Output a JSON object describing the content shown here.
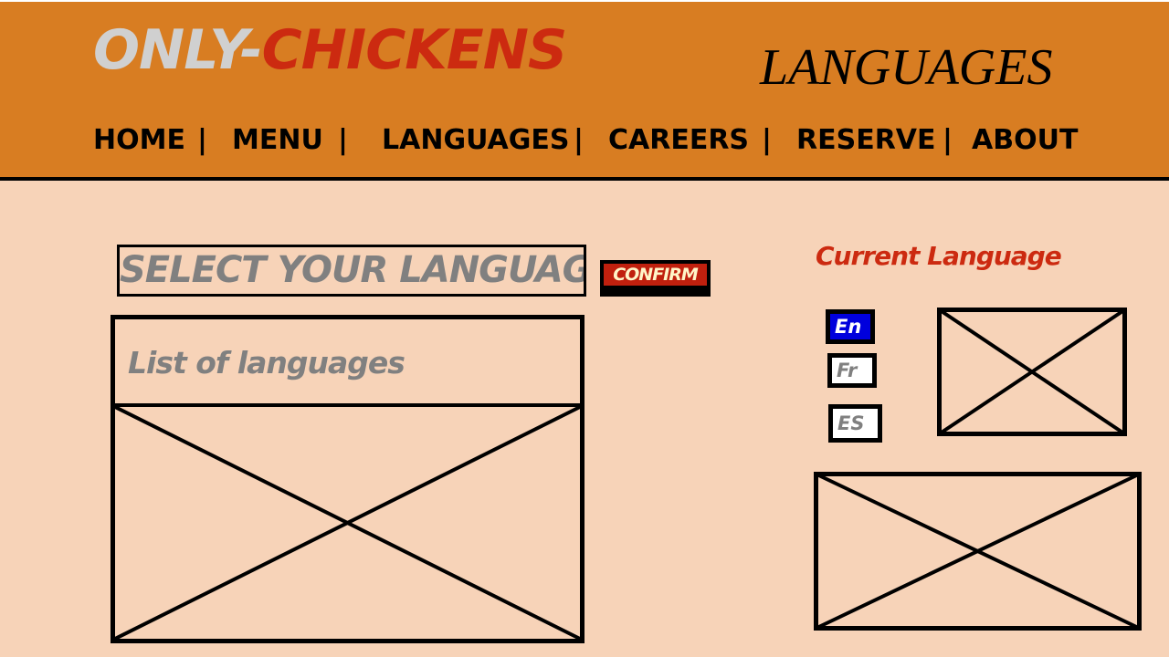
{
  "header": {
    "brand_part1": "ONLY-",
    "brand_part2": "CHICKENS",
    "page_heading": "LANGUAGES"
  },
  "nav": {
    "items": [
      {
        "label": "HOME"
      },
      {
        "label": "MENU"
      },
      {
        "label": "LANGUAGES"
      },
      {
        "label": "CAREERS"
      },
      {
        "label": "RESERVE"
      },
      {
        "label": "ABOUT"
      }
    ],
    "separator": "|"
  },
  "main": {
    "select_label": "SELECT YOUR LANGUAGE",
    "confirm_label": "CONFIRM",
    "list_title": "List of languages",
    "current_language_label": "Current Language",
    "language_buttons": [
      {
        "label": "En"
      },
      {
        "label": "Fr"
      },
      {
        "label": "ES"
      }
    ]
  },
  "colors": {
    "header_bg": "#d87d22",
    "page_bg": "#f7d3b8",
    "brand_accent": "#cc2a10",
    "active_language": "#0000dd"
  }
}
